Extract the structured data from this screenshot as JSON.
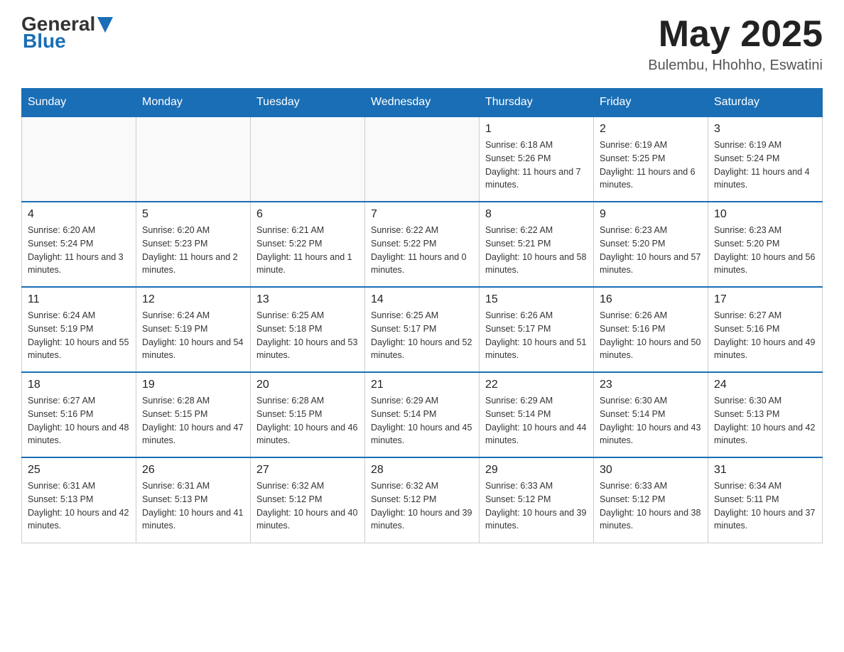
{
  "header": {
    "logo_general": "General",
    "logo_blue": "Blue",
    "month_year": "May 2025",
    "location": "Bulembu, Hhohho, Eswatini"
  },
  "days_of_week": [
    "Sunday",
    "Monday",
    "Tuesday",
    "Wednesday",
    "Thursday",
    "Friday",
    "Saturday"
  ],
  "weeks": [
    [
      {
        "day": "",
        "sunrise": "",
        "sunset": "",
        "daylight": ""
      },
      {
        "day": "",
        "sunrise": "",
        "sunset": "",
        "daylight": ""
      },
      {
        "day": "",
        "sunrise": "",
        "sunset": "",
        "daylight": ""
      },
      {
        "day": "",
        "sunrise": "",
        "sunset": "",
        "daylight": ""
      },
      {
        "day": "1",
        "sunrise": "Sunrise: 6:18 AM",
        "sunset": "Sunset: 5:26 PM",
        "daylight": "Daylight: 11 hours and 7 minutes."
      },
      {
        "day": "2",
        "sunrise": "Sunrise: 6:19 AM",
        "sunset": "Sunset: 5:25 PM",
        "daylight": "Daylight: 11 hours and 6 minutes."
      },
      {
        "day": "3",
        "sunrise": "Sunrise: 6:19 AM",
        "sunset": "Sunset: 5:24 PM",
        "daylight": "Daylight: 11 hours and 4 minutes."
      }
    ],
    [
      {
        "day": "4",
        "sunrise": "Sunrise: 6:20 AM",
        "sunset": "Sunset: 5:24 PM",
        "daylight": "Daylight: 11 hours and 3 minutes."
      },
      {
        "day": "5",
        "sunrise": "Sunrise: 6:20 AM",
        "sunset": "Sunset: 5:23 PM",
        "daylight": "Daylight: 11 hours and 2 minutes."
      },
      {
        "day": "6",
        "sunrise": "Sunrise: 6:21 AM",
        "sunset": "Sunset: 5:22 PM",
        "daylight": "Daylight: 11 hours and 1 minute."
      },
      {
        "day": "7",
        "sunrise": "Sunrise: 6:22 AM",
        "sunset": "Sunset: 5:22 PM",
        "daylight": "Daylight: 11 hours and 0 minutes."
      },
      {
        "day": "8",
        "sunrise": "Sunrise: 6:22 AM",
        "sunset": "Sunset: 5:21 PM",
        "daylight": "Daylight: 10 hours and 58 minutes."
      },
      {
        "day": "9",
        "sunrise": "Sunrise: 6:23 AM",
        "sunset": "Sunset: 5:20 PM",
        "daylight": "Daylight: 10 hours and 57 minutes."
      },
      {
        "day": "10",
        "sunrise": "Sunrise: 6:23 AM",
        "sunset": "Sunset: 5:20 PM",
        "daylight": "Daylight: 10 hours and 56 minutes."
      }
    ],
    [
      {
        "day": "11",
        "sunrise": "Sunrise: 6:24 AM",
        "sunset": "Sunset: 5:19 PM",
        "daylight": "Daylight: 10 hours and 55 minutes."
      },
      {
        "day": "12",
        "sunrise": "Sunrise: 6:24 AM",
        "sunset": "Sunset: 5:19 PM",
        "daylight": "Daylight: 10 hours and 54 minutes."
      },
      {
        "day": "13",
        "sunrise": "Sunrise: 6:25 AM",
        "sunset": "Sunset: 5:18 PM",
        "daylight": "Daylight: 10 hours and 53 minutes."
      },
      {
        "day": "14",
        "sunrise": "Sunrise: 6:25 AM",
        "sunset": "Sunset: 5:17 PM",
        "daylight": "Daylight: 10 hours and 52 minutes."
      },
      {
        "day": "15",
        "sunrise": "Sunrise: 6:26 AM",
        "sunset": "Sunset: 5:17 PM",
        "daylight": "Daylight: 10 hours and 51 minutes."
      },
      {
        "day": "16",
        "sunrise": "Sunrise: 6:26 AM",
        "sunset": "Sunset: 5:16 PM",
        "daylight": "Daylight: 10 hours and 50 minutes."
      },
      {
        "day": "17",
        "sunrise": "Sunrise: 6:27 AM",
        "sunset": "Sunset: 5:16 PM",
        "daylight": "Daylight: 10 hours and 49 minutes."
      }
    ],
    [
      {
        "day": "18",
        "sunrise": "Sunrise: 6:27 AM",
        "sunset": "Sunset: 5:16 PM",
        "daylight": "Daylight: 10 hours and 48 minutes."
      },
      {
        "day": "19",
        "sunrise": "Sunrise: 6:28 AM",
        "sunset": "Sunset: 5:15 PM",
        "daylight": "Daylight: 10 hours and 47 minutes."
      },
      {
        "day": "20",
        "sunrise": "Sunrise: 6:28 AM",
        "sunset": "Sunset: 5:15 PM",
        "daylight": "Daylight: 10 hours and 46 minutes."
      },
      {
        "day": "21",
        "sunrise": "Sunrise: 6:29 AM",
        "sunset": "Sunset: 5:14 PM",
        "daylight": "Daylight: 10 hours and 45 minutes."
      },
      {
        "day": "22",
        "sunrise": "Sunrise: 6:29 AM",
        "sunset": "Sunset: 5:14 PM",
        "daylight": "Daylight: 10 hours and 44 minutes."
      },
      {
        "day": "23",
        "sunrise": "Sunrise: 6:30 AM",
        "sunset": "Sunset: 5:14 PM",
        "daylight": "Daylight: 10 hours and 43 minutes."
      },
      {
        "day": "24",
        "sunrise": "Sunrise: 6:30 AM",
        "sunset": "Sunset: 5:13 PM",
        "daylight": "Daylight: 10 hours and 42 minutes."
      }
    ],
    [
      {
        "day": "25",
        "sunrise": "Sunrise: 6:31 AM",
        "sunset": "Sunset: 5:13 PM",
        "daylight": "Daylight: 10 hours and 42 minutes."
      },
      {
        "day": "26",
        "sunrise": "Sunrise: 6:31 AM",
        "sunset": "Sunset: 5:13 PM",
        "daylight": "Daylight: 10 hours and 41 minutes."
      },
      {
        "day": "27",
        "sunrise": "Sunrise: 6:32 AM",
        "sunset": "Sunset: 5:12 PM",
        "daylight": "Daylight: 10 hours and 40 minutes."
      },
      {
        "day": "28",
        "sunrise": "Sunrise: 6:32 AM",
        "sunset": "Sunset: 5:12 PM",
        "daylight": "Daylight: 10 hours and 39 minutes."
      },
      {
        "day": "29",
        "sunrise": "Sunrise: 6:33 AM",
        "sunset": "Sunset: 5:12 PM",
        "daylight": "Daylight: 10 hours and 39 minutes."
      },
      {
        "day": "30",
        "sunrise": "Sunrise: 6:33 AM",
        "sunset": "Sunset: 5:12 PM",
        "daylight": "Daylight: 10 hours and 38 minutes."
      },
      {
        "day": "31",
        "sunrise": "Sunrise: 6:34 AM",
        "sunset": "Sunset: 5:11 PM",
        "daylight": "Daylight: 10 hours and 37 minutes."
      }
    ]
  ]
}
